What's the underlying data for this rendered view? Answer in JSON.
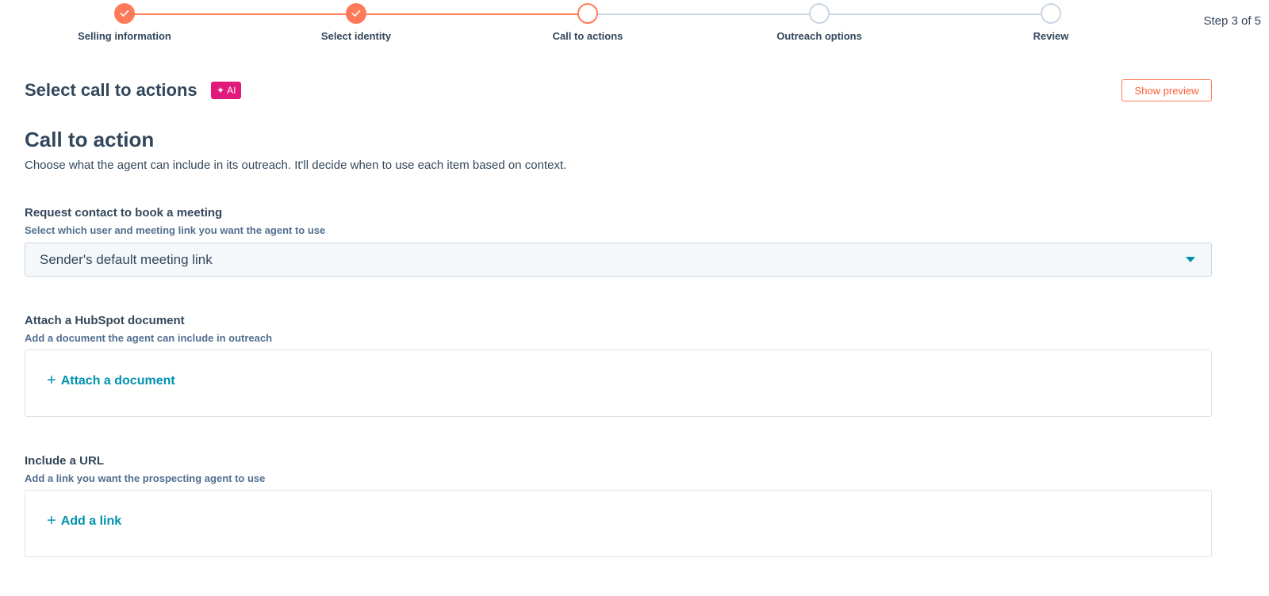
{
  "stepper": {
    "steps": [
      {
        "label": "Selling information",
        "status": "done"
      },
      {
        "label": "Select identity",
        "status": "done"
      },
      {
        "label": "Call to actions",
        "status": "current"
      },
      {
        "label": "Outreach options",
        "status": "todo"
      },
      {
        "label": "Review",
        "status": "todo"
      }
    ],
    "step_count": "Step 3 of 5"
  },
  "header": {
    "title": "Select call to actions",
    "ai_badge": "AI",
    "ai_badge_icon": "sparkle-icon",
    "preview_button": "Show preview"
  },
  "section": {
    "heading": "Call to action",
    "description": "Choose what the agent can include in its outreach. It'll decide when to use each item based on context."
  },
  "meeting": {
    "label": "Request contact to book a meeting",
    "help": "Select which user and meeting link you want the agent to use",
    "selected": "Sender's default meeting link"
  },
  "document": {
    "label": "Attach a HubSpot document",
    "help": "Add a document the agent can include in outreach",
    "action": "Attach a document"
  },
  "url": {
    "label": "Include a URL",
    "help": "Add a link you want the prospecting agent to use",
    "action": "Add a link"
  },
  "colors": {
    "accent": "#ff7a59",
    "link": "#0091ae",
    "ai_badge": "#e0197a",
    "text": "#33475b"
  }
}
